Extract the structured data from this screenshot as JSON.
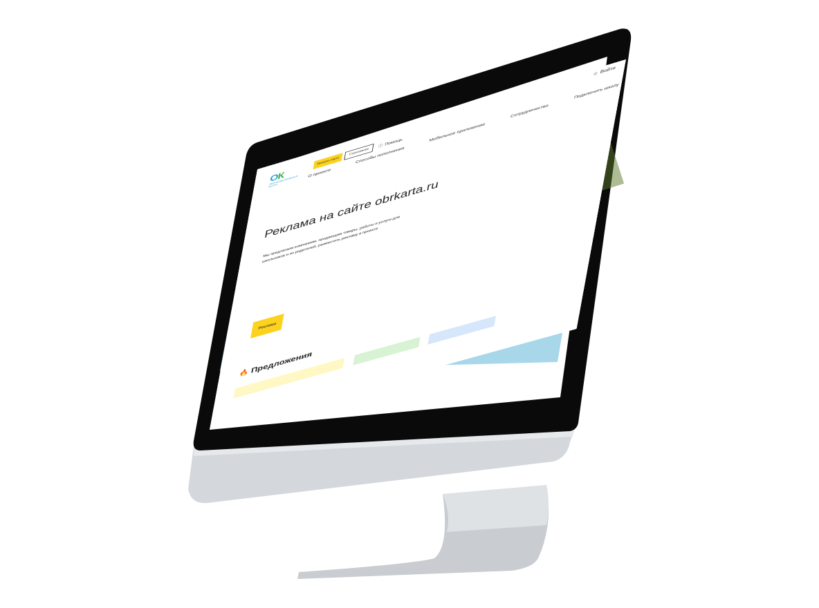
{
  "header": {
    "login_label": "Войти",
    "logo_mark_o": "О",
    "logo_mark_k": "К",
    "logo_text": "ОБРАЗОВАТЕЛЬНАЯ КАРТА",
    "order_card_label": "Заказать карту",
    "insurance_label": "Страхование",
    "help_label": "Помощь"
  },
  "nav": {
    "items": [
      {
        "label": "О проекте"
      },
      {
        "label": "Способы пополнения"
      },
      {
        "label": "Мобильное приложение"
      },
      {
        "label": "Сотрудничество"
      },
      {
        "label": "Подключить школу"
      }
    ]
  },
  "hero": {
    "title": "Реклама на сайте obrkarta.ru",
    "subtitle": "Мы предлагаем компаниям, продающим товары, работы и услуги для школьников и их родителей, разместить рекламу в проекте",
    "button_label": "Реклама"
  },
  "offers": {
    "title": "Предложения"
  },
  "colors": {
    "accent_yellow": "#fcd21f",
    "hero_bg": "#a8d7ea",
    "logo_green": "#3cb54a",
    "logo_blue": "#2b9fd8"
  }
}
